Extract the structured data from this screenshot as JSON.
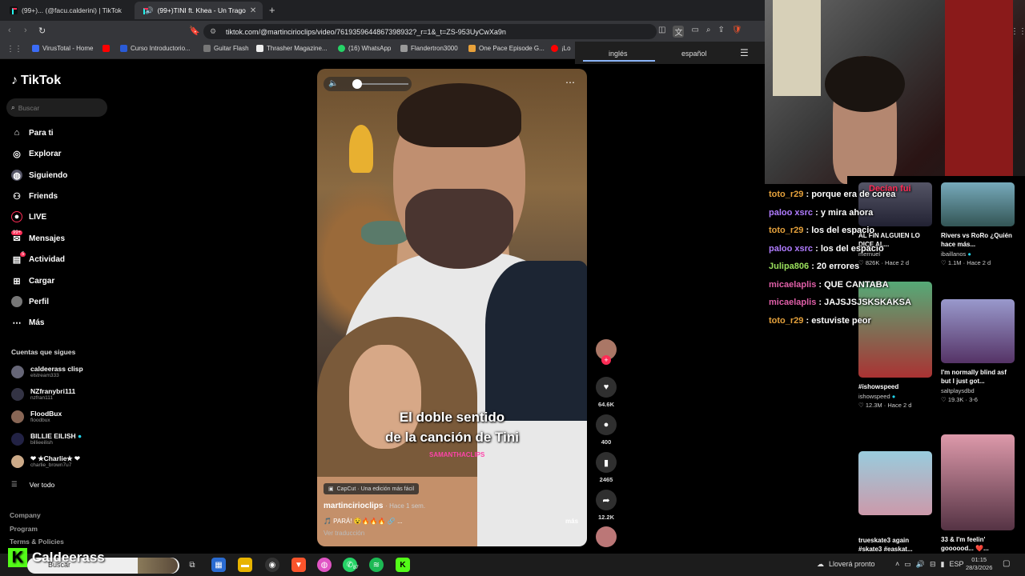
{
  "browser": {
    "tabs": [
      {
        "label": "(99+)... (@facu.calderini) | TikTok",
        "active": false
      },
      {
        "label": "(99+)TINI ft. Khea - Un Trago",
        "active": true
      }
    ],
    "new_tab": "+",
    "url": "tiktok.com/@martincirioclips/video/7619359644867398932?_r=1&_t=ZS-953UyCwXa9n",
    "bookmarks": [
      "VirusTotal - Home",
      "Curso Introductorio...",
      "Guitar Flash",
      "Thrasher Magazine...",
      "(16) WhatsApp",
      "Flandertron3000",
      "One Pace Episode G...",
      "¡Lo"
    ],
    "translate": {
      "from": "inglés",
      "to": "español"
    }
  },
  "sidebar": {
    "logo": "TikTok",
    "search_placeholder": "Buscar",
    "nav": [
      {
        "label": "Para ti",
        "icon": "home-icon"
      },
      {
        "label": "Explorar",
        "icon": "compass-icon"
      },
      {
        "label": "Siguiendo",
        "icon": "following-icon"
      },
      {
        "label": "Friends",
        "icon": "friends-icon"
      },
      {
        "label": "LIVE",
        "icon": "live-icon"
      },
      {
        "label": "Mensajes",
        "icon": "messages-icon",
        "badge": "99+"
      },
      {
        "label": "Actividad",
        "icon": "activity-icon",
        "badge": "5"
      },
      {
        "label": "Cargar",
        "icon": "upload-icon"
      },
      {
        "label": "Perfil",
        "icon": "profile-icon"
      },
      {
        "label": "Más",
        "icon": "more-icon"
      }
    ],
    "following_title": "Cuentas que sigues",
    "following": [
      {
        "name": "caldeerass clisp",
        "handle": "elstream333"
      },
      {
        "name": "NZfranybri111",
        "handle": "nzfran111"
      },
      {
        "name": "FloodBux",
        "handle": "floodbux"
      },
      {
        "name": "BILLIE EILISH",
        "handle": "billieeilish",
        "verified": true
      },
      {
        "name": "❤ ✮Charlie✮ ❤",
        "handle": "charlie_brown7u7"
      }
    ],
    "see_all": "Ver todo",
    "footer": [
      "Company",
      "Program",
      "Terms & Policies"
    ]
  },
  "video": {
    "caption_line1": "El doble sentido",
    "caption_line2": "de la canción de Tini",
    "watermark": "SAMANTHACLIPS",
    "capcut": "CapCut · Una edición más fácil",
    "author": "martincirioclips",
    "time": "· Hace 1 sem.",
    "desc": "🎵 PARÁ! 😵🔥🔥🔥 🔗 ...",
    "more": "más",
    "translate": "Ver traducción",
    "likes": "64.6K",
    "comments": "400",
    "saves": "2465",
    "shares": "12.2K"
  },
  "chat": [
    {
      "user": "toto_r29",
      "color": "#e6a23c",
      "msg": "porque era de corea"
    },
    {
      "user": "paloo xsrc",
      "color": "#b07cff",
      "msg": "y mira ahora"
    },
    {
      "user": "toto_r29",
      "color": "#e6a23c",
      "msg": "los del espacio"
    },
    {
      "user": "paloo xsrc",
      "color": "#b07cff",
      "msg": "los del espacio"
    },
    {
      "user": "Julipa806",
      "color": "#9be15d",
      "msg": "20 errores"
    },
    {
      "user": "micaelaplis",
      "color": "#e05fa8",
      "msg": "QUE CANTABA"
    },
    {
      "user": "micaelaplis",
      "color": "#e05fa8",
      "msg": "JAJSJSJSKSKAKSA"
    },
    {
      "user": "toto_r29",
      "color": "#e6a23c",
      "msg": "estuviste peor"
    }
  ],
  "overlay_text": "Decían fui",
  "cards": [
    {
      "title": "AL FIN ALGUIEN LO DICE AL...",
      "user": "mernuel",
      "likes": "826K",
      "time": "Hace 2 d"
    },
    {
      "title": "Rivers vs RoRo ¿Quién hace más...",
      "user": "ibaillanos",
      "likes": "1.1M",
      "time": "Hace 2 d"
    },
    {
      "title": "#ishowspeed",
      "user": "ishowspeed",
      "likes": "12.3M",
      "time": "Hace 2 d"
    },
    {
      "title": "I'm normally blind asf but I just got...",
      "user": "saltplaysdbd",
      "likes": "19.3K",
      "time": "3-6"
    },
    {
      "title": "trueskate3 again #skate3 #easkat...",
      "user": "",
      "likes": "",
      "time": ""
    },
    {
      "title": "33 & I'm feelin' goooood... ❤️...",
      "user": "",
      "likes": "",
      "time": ""
    }
  ],
  "brand": "Caldeerass",
  "taskbar": {
    "search": "Buscar",
    "weather": "Lloverá pronto",
    "lang": "ESP",
    "time": "01:15",
    "date": "28/3/2026",
    "whatsapp_badge": "87"
  },
  "colors": {
    "tiktok_red": "#fe2c55",
    "kick_green": "#53fc18"
  }
}
